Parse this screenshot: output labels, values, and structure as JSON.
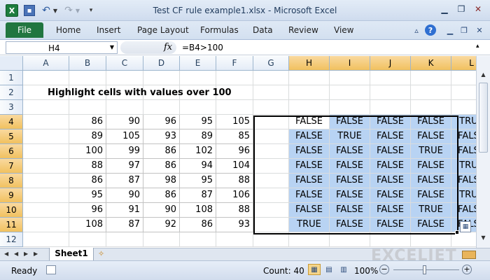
{
  "window": {
    "title": "Test CF rule example1.xlsx - Microsoft Excel",
    "app_icon": "X",
    "quick_access": [
      "save-icon",
      "undo-icon",
      "redo-icon",
      "customize-icon"
    ]
  },
  "ribbon": {
    "tabs": [
      "File",
      "Home",
      "Insert",
      "Page Layout",
      "Formulas",
      "Data",
      "Review",
      "View"
    ],
    "help": "?"
  },
  "formula_bar": {
    "name_box": "H4",
    "fx": "fx",
    "formula": "=B4>100"
  },
  "sheet": {
    "columns": [
      "A",
      "B",
      "C",
      "D",
      "E",
      "F",
      "G",
      "H",
      "I",
      "J",
      "K",
      "L"
    ],
    "rows": [
      "1",
      "2",
      "3",
      "4",
      "5",
      "6",
      "7",
      "8",
      "9",
      "10",
      "11",
      "12"
    ],
    "title": "Highlight cells with values over 100",
    "values": [
      [
        "86",
        "90",
        "96",
        "95",
        "105"
      ],
      [
        "89",
        "105",
        "93",
        "89",
        "85"
      ],
      [
        "100",
        "99",
        "86",
        "102",
        "96"
      ],
      [
        "88",
        "97",
        "86",
        "94",
        "104"
      ],
      [
        "86",
        "87",
        "98",
        "95",
        "88"
      ],
      [
        "95",
        "90",
        "86",
        "87",
        "106"
      ],
      [
        "96",
        "91",
        "90",
        "108",
        "88"
      ],
      [
        "108",
        "87",
        "92",
        "86",
        "93"
      ]
    ],
    "results": [
      [
        "FALSE",
        "FALSE",
        "FALSE",
        "FALSE",
        "TRUE"
      ],
      [
        "FALSE",
        "TRUE",
        "FALSE",
        "FALSE",
        "FALSE"
      ],
      [
        "FALSE",
        "FALSE",
        "FALSE",
        "TRUE",
        "FALSE"
      ],
      [
        "FALSE",
        "FALSE",
        "FALSE",
        "FALSE",
        "TRUE"
      ],
      [
        "FALSE",
        "FALSE",
        "FALSE",
        "FALSE",
        "FALSE"
      ],
      [
        "FALSE",
        "FALSE",
        "FALSE",
        "FALSE",
        "TRUE"
      ],
      [
        "FALSE",
        "FALSE",
        "FALSE",
        "TRUE",
        "FALSE"
      ],
      [
        "TRUE",
        "FALSE",
        "FALSE",
        "FALSE",
        "FALSE"
      ]
    ],
    "active_cell": "H4"
  },
  "sheet_tabs": {
    "active": "Sheet1",
    "watermark": "EXCELJET"
  },
  "status": {
    "ready": "Ready",
    "count": "Count: 40",
    "zoom": "100%",
    "zoom_minus": "−",
    "zoom_plus": "+"
  },
  "colors": {
    "selection_fill": "#b8d3f3",
    "file_tab": "#217640",
    "header_selected": "#f1c15f"
  }
}
